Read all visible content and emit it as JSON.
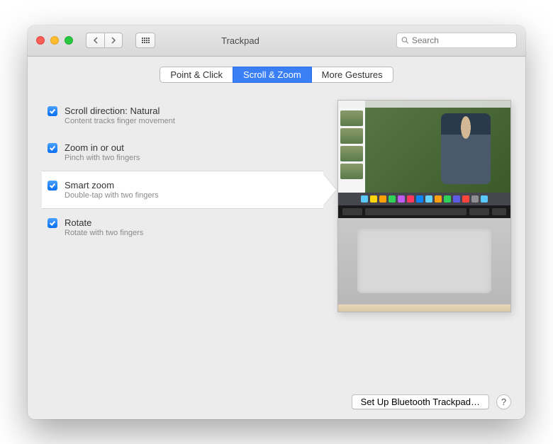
{
  "window": {
    "title": "Trackpad"
  },
  "search": {
    "placeholder": "Search"
  },
  "tabs": [
    {
      "label": "Point & Click",
      "active": false
    },
    {
      "label": "Scroll & Zoom",
      "active": true
    },
    {
      "label": "More Gestures",
      "active": false
    }
  ],
  "options": [
    {
      "label": "Scroll direction: Natural",
      "desc": "Content tracks finger movement",
      "checked": true,
      "selected": false
    },
    {
      "label": "Zoom in or out",
      "desc": "Pinch with two fingers",
      "checked": true,
      "selected": false
    },
    {
      "label": "Smart zoom",
      "desc": "Double-tap with two fingers",
      "checked": true,
      "selected": true
    },
    {
      "label": "Rotate",
      "desc": "Rotate with two fingers",
      "checked": true,
      "selected": false
    }
  ],
  "footer": {
    "bluetooth_label": "Set Up Bluetooth Trackpad…",
    "help_label": "?"
  },
  "dock_colors": [
    "#5ac8fa",
    "#ffd60a",
    "#ff9f0a",
    "#30d158",
    "#bf5af2",
    "#ff375f",
    "#0a84ff",
    "#64d2ff",
    "#ff9f0a",
    "#30d158",
    "#5e5ce6",
    "#ff453a",
    "#8e8e93",
    "#5ac8fa"
  ]
}
